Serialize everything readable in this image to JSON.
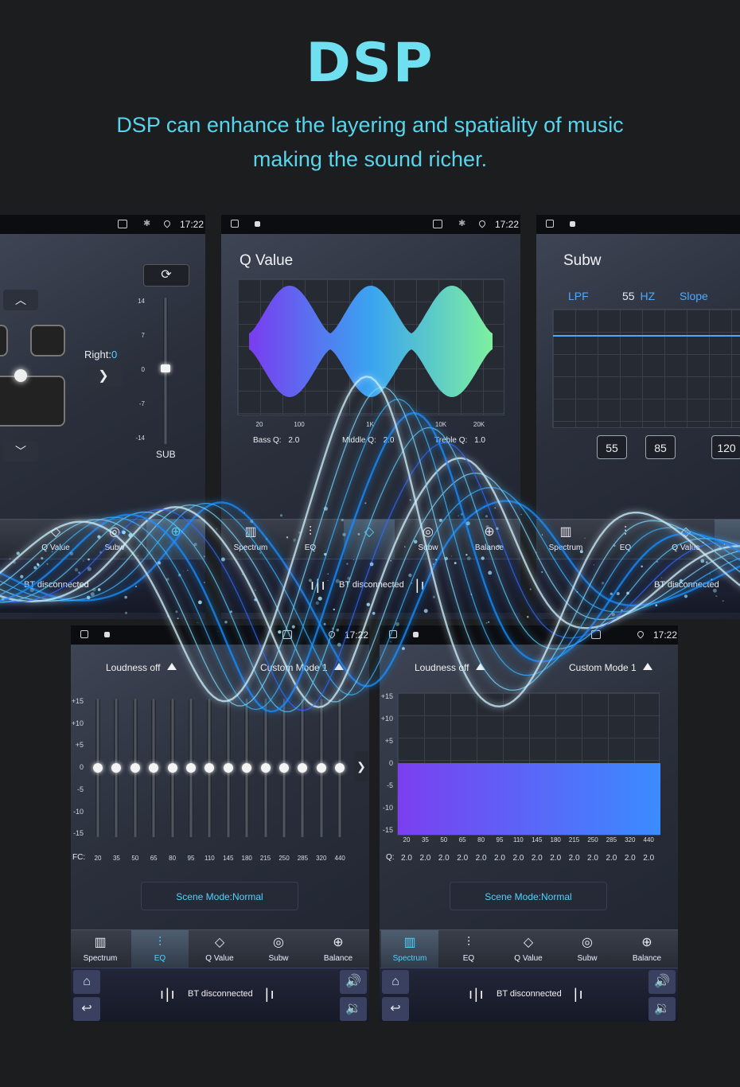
{
  "hero": {
    "title": "DSP",
    "subtitle_line1": "DSP can enhance the layering and spatiality of music",
    "subtitle_line2": "making the sound richer."
  },
  "colors": {
    "accent": "#4fd3ff",
    "title": "#6fe0f0",
    "background": "#1c1d1f"
  },
  "status": {
    "time": "17:22"
  },
  "screen_balance": {
    "right_label": "Right:",
    "right_value": "0",
    "sub_label": "SUB",
    "scale": [
      "14",
      "7",
      "0",
      "-7",
      "-14"
    ],
    "nav": [
      {
        "label": "Q Value",
        "icon": "diamond-icon"
      },
      {
        "label": "Subw",
        "icon": "speaker-icon"
      }
    ],
    "bt_text": "BT disconnected"
  },
  "screen_qvalue": {
    "title": "Q Value",
    "freq_ticks": [
      "20",
      "100",
      "1K",
      "10K",
      "20K"
    ],
    "bass_q_label": "Bass Q:",
    "bass_q": "2.0",
    "middle_q_label": "Middle Q:",
    "middle_q": "2.0",
    "treble_q_label": "Treble Q:",
    "treble_q": "1.0",
    "nav": [
      {
        "label": "Spectrum",
        "icon": "spectrum-icon"
      },
      {
        "label": "EQ",
        "icon": "eq-icon"
      },
      {
        "label": "Subw",
        "icon": "speaker-icon"
      },
      {
        "label": "Balance",
        "icon": "balance-icon"
      }
    ],
    "bt_text": "BT disconnected"
  },
  "screen_subw": {
    "title": "Subw",
    "lpf_label": "LPF",
    "hz_value": "55",
    "hz_unit": "HZ",
    "slope_label": "Slope",
    "chips": [
      "55",
      "85",
      "120"
    ],
    "nav": [
      {
        "label": "Spectrum",
        "icon": "spectrum-icon"
      },
      {
        "label": "EQ",
        "icon": "eq-icon"
      },
      {
        "label": "Q Value",
        "icon": "diamond-icon"
      }
    ],
    "bt_text": "BT disconnected"
  },
  "screen_eq": {
    "loudness": "Loudness off",
    "mode": "Custom Mode 1",
    "y_axis": [
      "+15",
      "+10",
      "+5",
      "0",
      "-5",
      "-10",
      "-15"
    ],
    "fc_label": "FC:",
    "fc": [
      "20",
      "35",
      "50",
      "65",
      "80",
      "95",
      "110",
      "145",
      "180",
      "215",
      "250",
      "285",
      "320",
      "440"
    ],
    "gains": [
      0,
      0,
      0,
      0,
      0,
      0,
      0,
      0,
      0,
      0,
      0,
      0,
      0,
      0
    ],
    "scene": "Scene Mode:Normal",
    "nav": [
      {
        "label": "Spectrum",
        "icon": "spectrum-icon"
      },
      {
        "label": "EQ",
        "icon": "eq-icon",
        "active": true
      },
      {
        "label": "Q Value",
        "icon": "diamond-icon"
      },
      {
        "label": "Subw",
        "icon": "speaker-icon"
      },
      {
        "label": "Balance",
        "icon": "balance-icon"
      }
    ],
    "bt_text": "BT disconnected"
  },
  "screen_spectrum": {
    "loudness": "Loudness off",
    "mode": "Custom Mode 1",
    "y_axis": [
      "+15",
      "+10",
      "+5",
      "0",
      "-5",
      "-10",
      "-15"
    ],
    "freq": [
      "20",
      "35",
      "50",
      "65",
      "80",
      "95",
      "110",
      "145",
      "180",
      "215",
      "250",
      "285",
      "320",
      "440"
    ],
    "q_label": "Q:",
    "q": [
      "2.0",
      "2.0",
      "2.0",
      "2.0",
      "2.0",
      "2.0",
      "2.0",
      "2.0",
      "2.0",
      "2.0",
      "2.0",
      "2.0",
      "2.0",
      "2.0"
    ],
    "scene": "Scene Mode:Normal",
    "nav": [
      {
        "label": "Spectrum",
        "icon": "spectrum-icon",
        "active": true
      },
      {
        "label": "EQ",
        "icon": "eq-icon"
      },
      {
        "label": "Q Value",
        "icon": "diamond-icon"
      },
      {
        "label": "Subw",
        "icon": "speaker-icon"
      },
      {
        "label": "Balance",
        "icon": "balance-icon"
      }
    ],
    "bt_text": "BT disconnected"
  }
}
